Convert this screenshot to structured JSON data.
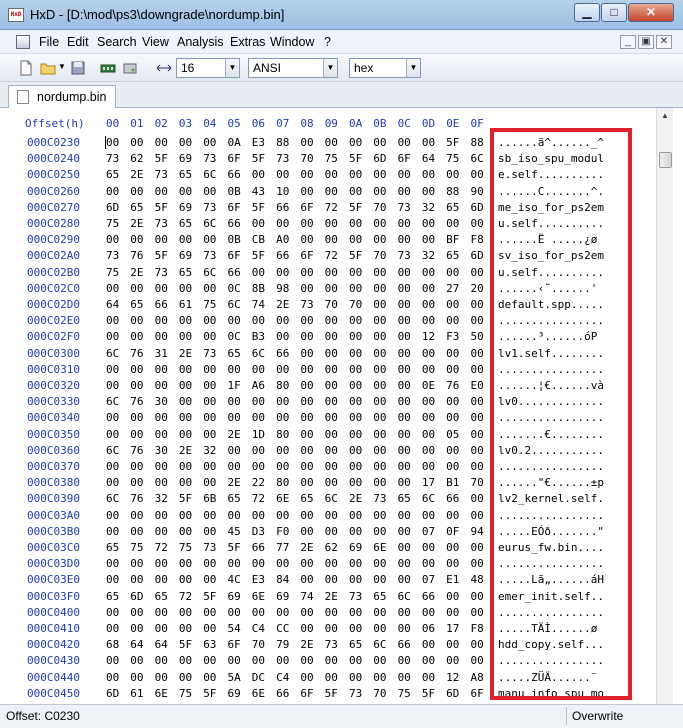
{
  "window": {
    "title": "HxD - [D:\\mod\\ps3\\downgrade\\nordump.bin]",
    "app_icon_text": "HxD"
  },
  "menu": [
    "File",
    "Edit",
    "Search",
    "View",
    "Analysis",
    "Extras",
    "Window",
    "?"
  ],
  "toolbar": {
    "columns_value": "16",
    "charset_value": "ANSI",
    "display_value": "hex"
  },
  "tab": {
    "label": "nordump.bin"
  },
  "editor": {
    "offset_header": "Offset(h)",
    "column_headers": [
      "00",
      "01",
      "02",
      "03",
      "04",
      "05",
      "06",
      "07",
      "08",
      "09",
      "0A",
      "0B",
      "0C",
      "0D",
      "0E",
      "0F"
    ],
    "rows": [
      {
        "offset": "000C0230",
        "hex": [
          "00",
          "00",
          "00",
          "00",
          "00",
          "0A",
          "E3",
          "88",
          "00",
          "00",
          "00",
          "00",
          "00",
          "00",
          "5F",
          "88"
        ],
        "ascii": "......ã^......_^"
      },
      {
        "offset": "000C0240",
        "hex": [
          "73",
          "62",
          "5F",
          "69",
          "73",
          "6F",
          "5F",
          "73",
          "70",
          "75",
          "5F",
          "6D",
          "6F",
          "64",
          "75",
          "6C"
        ],
        "ascii": "sb_iso_spu_modul"
      },
      {
        "offset": "000C0250",
        "hex": [
          "65",
          "2E",
          "73",
          "65",
          "6C",
          "66",
          "00",
          "00",
          "00",
          "00",
          "00",
          "00",
          "00",
          "00",
          "00",
          "00"
        ],
        "ascii": "e.self.........."
      },
      {
        "offset": "000C0260",
        "hex": [
          "00",
          "00",
          "00",
          "00",
          "00",
          "0B",
          "43",
          "10",
          "00",
          "00",
          "00",
          "00",
          "00",
          "00",
          "88",
          "90"
        ],
        "ascii": "......C.......^."
      },
      {
        "offset": "000C0270",
        "hex": [
          "6D",
          "65",
          "5F",
          "69",
          "73",
          "6F",
          "5F",
          "66",
          "6F",
          "72",
          "5F",
          "70",
          "73",
          "32",
          "65",
          "6D"
        ],
        "ascii": "me_iso_for_ps2em"
      },
      {
        "offset": "000C0280",
        "hex": [
          "75",
          "2E",
          "73",
          "65",
          "6C",
          "66",
          "00",
          "00",
          "00",
          "00",
          "00",
          "00",
          "00",
          "00",
          "00",
          "00"
        ],
        "ascii": "u.self.........."
      },
      {
        "offset": "000C0290",
        "hex": [
          "00",
          "00",
          "00",
          "00",
          "00",
          "0B",
          "CB",
          "A0",
          "00",
          "00",
          "00",
          "00",
          "00",
          "00",
          "BF",
          "F8"
        ],
        "ascii": "......Ë .....¿ø"
      },
      {
        "offset": "000C02A0",
        "hex": [
          "73",
          "76",
          "5F",
          "69",
          "73",
          "6F",
          "5F",
          "66",
          "6F",
          "72",
          "5F",
          "70",
          "73",
          "32",
          "65",
          "6D"
        ],
        "ascii": "sv_iso_for_ps2em"
      },
      {
        "offset": "000C02B0",
        "hex": [
          "75",
          "2E",
          "73",
          "65",
          "6C",
          "66",
          "00",
          "00",
          "00",
          "00",
          "00",
          "00",
          "00",
          "00",
          "00",
          "00"
        ],
        "ascii": "u.self.........."
      },
      {
        "offset": "000C02C0",
        "hex": [
          "00",
          "00",
          "00",
          "00",
          "00",
          "0C",
          "8B",
          "98",
          "00",
          "00",
          "00",
          "00",
          "00",
          "00",
          "27",
          "20"
        ],
        "ascii": "......‹˜......' "
      },
      {
        "offset": "000C02D0",
        "hex": [
          "64",
          "65",
          "66",
          "61",
          "75",
          "6C",
          "74",
          "2E",
          "73",
          "70",
          "70",
          "00",
          "00",
          "00",
          "00",
          "00"
        ],
        "ascii": "default.spp....."
      },
      {
        "offset": "000C02E0",
        "hex": [
          "00",
          "00",
          "00",
          "00",
          "00",
          "00",
          "00",
          "00",
          "00",
          "00",
          "00",
          "00",
          "00",
          "00",
          "00",
          "00"
        ],
        "ascii": "................"
      },
      {
        "offset": "000C02F0",
        "hex": [
          "00",
          "00",
          "00",
          "00",
          "00",
          "0C",
          "B3",
          "00",
          "00",
          "00",
          "00",
          "00",
          "00",
          "12",
          "F3",
          "50"
        ],
        "ascii": "......³......óP"
      },
      {
        "offset": "000C0300",
        "hex": [
          "6C",
          "76",
          "31",
          "2E",
          "73",
          "65",
          "6C",
          "66",
          "00",
          "00",
          "00",
          "00",
          "00",
          "00",
          "00",
          "00"
        ],
        "ascii": "lv1.self........"
      },
      {
        "offset": "000C0310",
        "hex": [
          "00",
          "00",
          "00",
          "00",
          "00",
          "00",
          "00",
          "00",
          "00",
          "00",
          "00",
          "00",
          "00",
          "00",
          "00",
          "00"
        ],
        "ascii": "................"
      },
      {
        "offset": "000C0320",
        "hex": [
          "00",
          "00",
          "00",
          "00",
          "00",
          "1F",
          "A6",
          "80",
          "00",
          "00",
          "00",
          "00",
          "00",
          "0E",
          "76",
          "E0"
        ],
        "ascii": "......¦€......và"
      },
      {
        "offset": "000C0330",
        "hex": [
          "6C",
          "76",
          "30",
          "00",
          "00",
          "00",
          "00",
          "00",
          "00",
          "00",
          "00",
          "00",
          "00",
          "00",
          "00",
          "00"
        ],
        "ascii": "lv0............."
      },
      {
        "offset": "000C0340",
        "hex": [
          "00",
          "00",
          "00",
          "00",
          "00",
          "00",
          "00",
          "00",
          "00",
          "00",
          "00",
          "00",
          "00",
          "00",
          "00",
          "00"
        ],
        "ascii": "................"
      },
      {
        "offset": "000C0350",
        "hex": [
          "00",
          "00",
          "00",
          "00",
          "00",
          "2E",
          "1D",
          "80",
          "00",
          "00",
          "00",
          "00",
          "00",
          "00",
          "05",
          "00"
        ],
        "ascii": ".......€........"
      },
      {
        "offset": "000C0360",
        "hex": [
          "6C",
          "76",
          "30",
          "2E",
          "32",
          "00",
          "00",
          "00",
          "00",
          "00",
          "00",
          "00",
          "00",
          "00",
          "00",
          "00"
        ],
        "ascii": "lv0.2..........."
      },
      {
        "offset": "000C0370",
        "hex": [
          "00",
          "00",
          "00",
          "00",
          "00",
          "00",
          "00",
          "00",
          "00",
          "00",
          "00",
          "00",
          "00",
          "00",
          "00",
          "00"
        ],
        "ascii": "................"
      },
      {
        "offset": "000C0380",
        "hex": [
          "00",
          "00",
          "00",
          "00",
          "00",
          "2E",
          "22",
          "80",
          "00",
          "00",
          "00",
          "00",
          "00",
          "17",
          "B1",
          "70"
        ],
        "ascii": "......\"€......±p"
      },
      {
        "offset": "000C0390",
        "hex": [
          "6C",
          "76",
          "32",
          "5F",
          "6B",
          "65",
          "72",
          "6E",
          "65",
          "6C",
          "2E",
          "73",
          "65",
          "6C",
          "66",
          "00"
        ],
        "ascii": "lv2_kernel.self."
      },
      {
        "offset": "000C03A0",
        "hex": [
          "00",
          "00",
          "00",
          "00",
          "00",
          "00",
          "00",
          "00",
          "00",
          "00",
          "00",
          "00",
          "00",
          "00",
          "00",
          "00"
        ],
        "ascii": "................"
      },
      {
        "offset": "000C03B0",
        "hex": [
          "00",
          "00",
          "00",
          "00",
          "00",
          "45",
          "D3",
          "F0",
          "00",
          "00",
          "00",
          "00",
          "00",
          "07",
          "0F",
          "94"
        ],
        "ascii": ".....EÓð.......\""
      },
      {
        "offset": "000C03C0",
        "hex": [
          "65",
          "75",
          "72",
          "75",
          "73",
          "5F",
          "66",
          "77",
          "2E",
          "62",
          "69",
          "6E",
          "00",
          "00",
          "00",
          "00"
        ],
        "ascii": "eurus_fw.bin...."
      },
      {
        "offset": "000C03D0",
        "hex": [
          "00",
          "00",
          "00",
          "00",
          "00",
          "00",
          "00",
          "00",
          "00",
          "00",
          "00",
          "00",
          "00",
          "00",
          "00",
          "00"
        ],
        "ascii": "................"
      },
      {
        "offset": "000C03E0",
        "hex": [
          "00",
          "00",
          "00",
          "00",
          "00",
          "4C",
          "E3",
          "84",
          "00",
          "00",
          "00",
          "00",
          "00",
          "07",
          "E1",
          "48"
        ],
        "ascii": ".....Lã„......áH"
      },
      {
        "offset": "000C03F0",
        "hex": [
          "65",
          "6D",
          "65",
          "72",
          "5F",
          "69",
          "6E",
          "69",
          "74",
          "2E",
          "73",
          "65",
          "6C",
          "66",
          "00",
          "00"
        ],
        "ascii": "emer_init.self.."
      },
      {
        "offset": "000C0400",
        "hex": [
          "00",
          "00",
          "00",
          "00",
          "00",
          "00",
          "00",
          "00",
          "00",
          "00",
          "00",
          "00",
          "00",
          "00",
          "00",
          "00"
        ],
        "ascii": "................"
      },
      {
        "offset": "000C0410",
        "hex": [
          "00",
          "00",
          "00",
          "00",
          "00",
          "54",
          "C4",
          "CC",
          "00",
          "00",
          "00",
          "00",
          "00",
          "06",
          "17",
          "F8"
        ],
        "ascii": ".....TÄÌ......ø"
      },
      {
        "offset": "000C0420",
        "hex": [
          "68",
          "64",
          "64",
          "5F",
          "63",
          "6F",
          "70",
          "79",
          "2E",
          "73",
          "65",
          "6C",
          "66",
          "00",
          "00",
          "00"
        ],
        "ascii": "hdd_copy.self..."
      },
      {
        "offset": "000C0430",
        "hex": [
          "00",
          "00",
          "00",
          "00",
          "00",
          "00",
          "00",
          "00",
          "00",
          "00",
          "00",
          "00",
          "00",
          "00",
          "00",
          "00"
        ],
        "ascii": "................"
      },
      {
        "offset": "000C0440",
        "hex": [
          "00",
          "00",
          "00",
          "00",
          "00",
          "5A",
          "DC",
          "C4",
          "00",
          "00",
          "00",
          "00",
          "00",
          "00",
          "12",
          "A8"
        ],
        "ascii": ".....ZÜÄ......¨"
      },
      {
        "offset": "000C0450",
        "hex": [
          "6D",
          "61",
          "6E",
          "75",
          "5F",
          "69",
          "6E",
          "66",
          "6F",
          "5F",
          "73",
          "70",
          "75",
          "5F",
          "6D",
          "6F"
        ],
        "ascii": "manu_info_spu_mo"
      }
    ]
  },
  "status": {
    "offset": "Offset: C0230",
    "mode": "Overwrite"
  },
  "colors": {
    "offset_blue": "#1f3ca8",
    "highlight_red": "#e0202a"
  }
}
